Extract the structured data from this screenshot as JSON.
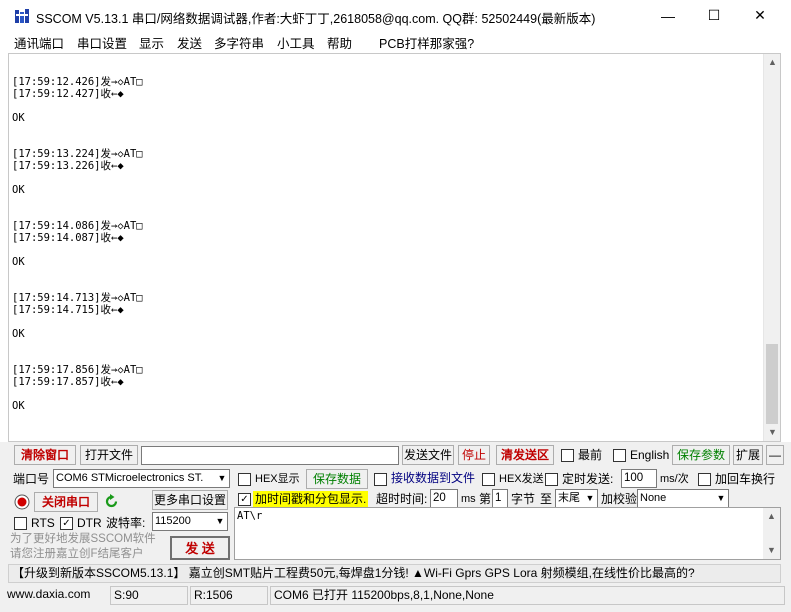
{
  "window": {
    "title": "SSCOM V5.13.1 串口/网络数据调试器,作者:大虾丁丁,2618058@qq.com. QQ群: 52502449(最新版本)",
    "minimize": "—",
    "maximize": "☐",
    "close": "✕"
  },
  "menu": [
    "通讯端口",
    "串口设置",
    "显示",
    "发送",
    "多字符串",
    "小工具",
    "帮助",
    "PCB打样那家强?"
  ],
  "log": "[17:59:12.426]发→◇AT□\n[17:59:12.427]收←◆\n\nOK\n\n\n[17:59:13.224]发→◇AT□\n[17:59:13.226]收←◆\n\nOK\n\n\n[17:59:14.086]发→◇AT□\n[17:59:14.087]收←◆\n\nOK\n\n\n[17:59:14.713]发→◇AT□\n[17:59:14.715]收←◆\n\nOK\n\n\n[17:59:17.856]发→◇AT□\n[17:59:17.857]收←◆\n\nOK",
  "row1": {
    "clear_window": "清除窗口",
    "open_file": "打开文件",
    "file_path": "",
    "send_file": "发送文件",
    "stop": "停止",
    "clear_send": "清发送区",
    "topmost": "最前",
    "english": "English",
    "save_params": "保存参数",
    "expand": "扩展",
    "collapse": "—"
  },
  "row2": {
    "port_label": "端口号",
    "port_value": "COM6 STMicroelectronics ST.",
    "hex_display": "HEX显示",
    "save_data": "保存数据",
    "recv_to_file": "接收数据到文件",
    "hex_send": "HEX发送",
    "timed_send": "定时发送:",
    "interval": "100",
    "interval_unit": "ms/次",
    "add_crlf": "加回车换行"
  },
  "row3": {
    "close_port": "关闭串口",
    "more_settings": "更多串口设置",
    "timestamp_label": "加时间戳和分包显示.",
    "timeout_label": "超时时间:",
    "timeout_value": "20",
    "timeout_unit": "ms",
    "nth_label": "第",
    "nth_value": "1",
    "byte_label": "字节",
    "to_label": "至",
    "end_value": "末尾",
    "checksum_label": "加校验",
    "checksum_value": "None"
  },
  "row4": {
    "rts": "RTS",
    "dtr": "DTR",
    "baud_label": "波特率:",
    "baud_value": "115200"
  },
  "send": {
    "text": "AT\\r",
    "button": "发  送"
  },
  "ad": {
    "line1": "为了更好地发展SSCOM软件",
    "line2": "请您注册嘉立创F结尾客户"
  },
  "promo": "【升级到新版本SSCOM5.13.1】    嘉立创SMT贴片工程费50元,每焊盘1分钱! ▲Wi-Fi Gprs GPS Lora 射频模组,在线性价比最高的?",
  "status": {
    "website": "www.daxia.com",
    "sent": "S:90",
    "received": "R:1506",
    "port_info": "COM6 已打开  115200bps,8,1,None,None"
  },
  "colors": {
    "accent_red": "#c00000",
    "accent_green": "#008000",
    "highlight": "#ffff00"
  }
}
